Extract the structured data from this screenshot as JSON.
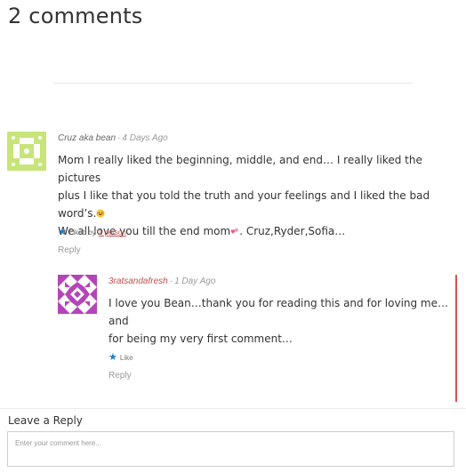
{
  "heading": "2 comments",
  "comments": [
    {
      "author": "Cruz aka bean",
      "time": "4 Days Ago",
      "body_line1": "Mom I really liked the beginning, middle, and end… I really liked the pictures",
      "body_line2": "plus I like that you told the truth and your feelings and I liked the bad word’s.",
      "body_line3_a": "We all love you till the end mom",
      "body_line3_b": ". Cruz,Ryder,Sofia…",
      "liked_prefix": "Liked by",
      "liked_link": "1 person",
      "reply_label": "Reply",
      "avatar_color": "#c7e57a"
    },
    {
      "author": "3ratsandafresh",
      "time": "1 Day Ago",
      "body_line1": "I love you Bean…thank you for reading this and for loving me…and",
      "body_line2": "for being my very first comment…",
      "like_label": "Like",
      "reply_label": "Reply",
      "avatar_color": "#b445b8"
    }
  ],
  "leave_reply": {
    "title": "Leave a Reply",
    "placeholder": "Enter your comment here..."
  },
  "colors": {
    "accent": "#d9534f",
    "star": "#1e7ac2"
  }
}
